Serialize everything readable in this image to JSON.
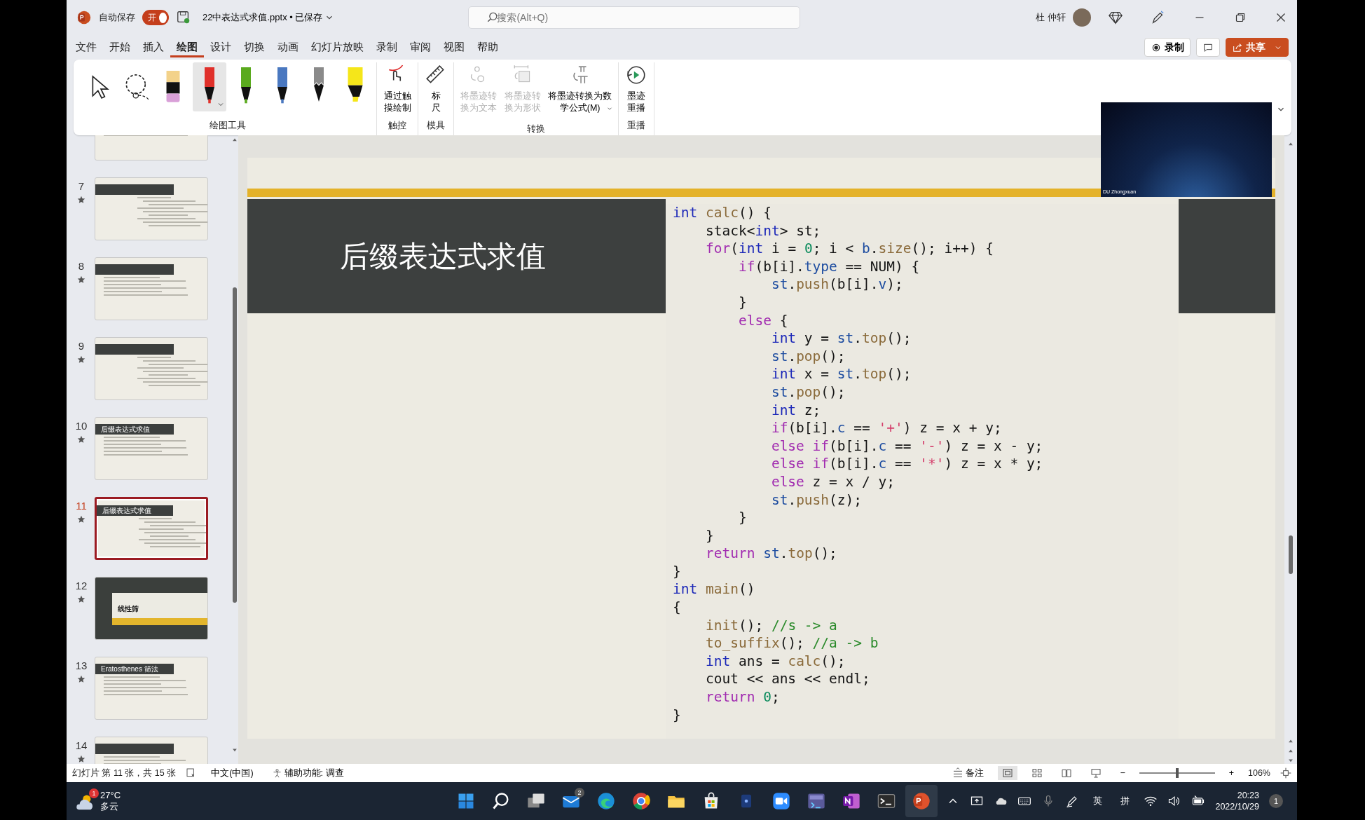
{
  "title_bar": {
    "autosave": {
      "label": "自动保存",
      "toggle_label": "开",
      "on": true
    },
    "file_name": "22中表达式求值.pptx • 已保存",
    "search": {
      "placeholder": "搜索(Alt+Q)"
    },
    "user": {
      "name": "杜 仲轩"
    }
  },
  "ribbon_tabs": [
    {
      "label": "文件",
      "selected": false
    },
    {
      "label": "开始",
      "selected": false
    },
    {
      "label": "插入",
      "selected": false
    },
    {
      "label": "绘图",
      "selected": true
    },
    {
      "label": "设计",
      "selected": false
    },
    {
      "label": "切换",
      "selected": false
    },
    {
      "label": "动画",
      "selected": false
    },
    {
      "label": "幻灯片放映",
      "selected": false
    },
    {
      "label": "录制",
      "selected": false
    },
    {
      "label": "审阅",
      "selected": false
    },
    {
      "label": "视图",
      "selected": false
    },
    {
      "label": "帮助",
      "selected": false
    }
  ],
  "actions": [
    {
      "kind": "record",
      "label": "录制"
    },
    {
      "kind": "comment"
    },
    {
      "kind": "share",
      "label": "共享"
    }
  ],
  "ribbon_groups": [
    {
      "label": "绘图工具",
      "tools": [
        {
          "kind": "select",
          "selected": false
        },
        {
          "kind": "lasso",
          "selected": false
        },
        {
          "kind": "eraser",
          "selected": false
        },
        {
          "kind": "pen",
          "color": "#e0302a",
          "selected": true,
          "dropdown": true
        },
        {
          "kind": "pen",
          "color": "#5aaa1e",
          "selected": false
        },
        {
          "kind": "pen",
          "color": "#4a78c0",
          "selected": false
        },
        {
          "kind": "pencil",
          "color": "#8a8a8a",
          "selected": false
        },
        {
          "kind": "highlighter",
          "color": "#f5e61a",
          "selected": false
        }
      ]
    },
    {
      "label": "触控",
      "tools": [
        {
          "kind": "touch",
          "label": "通过触摸绘制",
          "disabled": false
        }
      ]
    },
    {
      "label": "模具",
      "tools": [
        {
          "kind": "ruler",
          "label": "标尺",
          "disabled": false
        }
      ]
    },
    {
      "label": "转换",
      "tools": [
        {
          "kind": "ink-text",
          "label": "将墨迹转换为文本",
          "disabled": true
        },
        {
          "kind": "ink-shape",
          "label": "将墨迹转换为形状",
          "disabled": true
        },
        {
          "kind": "ink-math",
          "label": "将墨迹转换为数学公式(M)",
          "disabled": false,
          "dropdown": true
        }
      ]
    },
    {
      "label": "重播",
      "tools": [
        {
          "kind": "replay",
          "label": "墨迹重播",
          "disabled": false
        }
      ]
    }
  ],
  "slides": [
    {
      "kind": "text",
      "selected": false
    },
    {
      "kind": "code",
      "number": "7",
      "selected": false
    },
    {
      "kind": "text",
      "number": "8",
      "selected": false
    },
    {
      "kind": "code",
      "number": "9",
      "selected": false
    },
    {
      "kind": "text",
      "number": "10",
      "title": "后缀表达式求值",
      "selected": false
    },
    {
      "kind": "code",
      "number": "11",
      "title": "后缀表达式求值",
      "selected": true
    },
    {
      "kind": "section",
      "number": "12",
      "title": "线性筛",
      "selected": false
    },
    {
      "kind": "text",
      "number": "13",
      "title": "Eratosthenes 筛法",
      "selected": false
    },
    {
      "kind": "text",
      "number": "14",
      "selected": false
    }
  ],
  "slide": {
    "title": "后缀表达式求值",
    "code": [
      [
        {
          "text": "int",
          "kind": "type"
        },
        {
          "text": " calc",
          "kind": "fn"
        },
        {
          "text": "() {",
          "kind": "p"
        }
      ],
      [
        {
          "text": "    stack<",
          "kind": "p"
        },
        {
          "text": "int",
          "kind": "type"
        },
        {
          "text": "> st;",
          "kind": "p"
        }
      ],
      [
        {
          "text": "    for",
          "kind": "kw"
        },
        {
          "text": "(",
          "kind": "p"
        },
        {
          "text": "int",
          "kind": "type"
        },
        {
          "text": " i = ",
          "kind": "p"
        },
        {
          "text": "0",
          "kind": "num"
        },
        {
          "text": "; i < ",
          "kind": "p"
        },
        {
          "text": "b",
          "kind": "mem"
        },
        {
          "text": ".",
          "kind": "p"
        },
        {
          "text": "size",
          "kind": "fn"
        },
        {
          "text": "(); i++) {",
          "kind": "p"
        }
      ],
      [
        {
          "text": "        if",
          "kind": "kw"
        },
        {
          "text": "(b[i].",
          "kind": "p"
        },
        {
          "text": "type",
          "kind": "mem"
        },
        {
          "text": " == NUM) {",
          "kind": "p"
        }
      ],
      [
        {
          "text": "            st",
          "kind": "mem"
        },
        {
          "text": ".",
          "kind": "p"
        },
        {
          "text": "push",
          "kind": "fn"
        },
        {
          "text": "(b[i].",
          "kind": "p"
        },
        {
          "text": "v",
          "kind": "mem"
        },
        {
          "text": ");",
          "kind": "p"
        }
      ],
      [
        {
          "text": "        }",
          "kind": "p"
        }
      ],
      [
        {
          "text": "        else",
          "kind": "kw"
        },
        {
          "text": " {",
          "kind": "p"
        }
      ],
      [
        {
          "text": "            int",
          "kind": "type"
        },
        {
          "text": " y = ",
          "kind": "p"
        },
        {
          "text": "st",
          "kind": "mem"
        },
        {
          "text": ".",
          "kind": "p"
        },
        {
          "text": "top",
          "kind": "fn"
        },
        {
          "text": "();",
          "kind": "p"
        }
      ],
      [
        {
          "text": "            st",
          "kind": "mem"
        },
        {
          "text": ".",
          "kind": "p"
        },
        {
          "text": "pop",
          "kind": "fn"
        },
        {
          "text": "();",
          "kind": "p"
        }
      ],
      [
        {
          "text": "            int",
          "kind": "type"
        },
        {
          "text": " x = ",
          "kind": "p"
        },
        {
          "text": "st",
          "kind": "mem"
        },
        {
          "text": ".",
          "kind": "p"
        },
        {
          "text": "top",
          "kind": "fn"
        },
        {
          "text": "();",
          "kind": "p"
        }
      ],
      [
        {
          "text": "            st",
          "kind": "mem"
        },
        {
          "text": ".",
          "kind": "p"
        },
        {
          "text": "pop",
          "kind": "fn"
        },
        {
          "text": "();",
          "kind": "p"
        }
      ],
      [
        {
          "text": "            int",
          "kind": "type"
        },
        {
          "text": " z;",
          "kind": "p"
        }
      ],
      [
        {
          "text": "            if",
          "kind": "kw"
        },
        {
          "text": "(b[i].",
          "kind": "p"
        },
        {
          "text": "c",
          "kind": "mem"
        },
        {
          "text": " == ",
          "kind": "p"
        },
        {
          "text": "'+'",
          "kind": "str"
        },
        {
          "text": ") z = x + y;",
          "kind": "p"
        }
      ],
      [
        {
          "text": "            else if",
          "kind": "kw"
        },
        {
          "text": "(b[i].",
          "kind": "p"
        },
        {
          "text": "c",
          "kind": "mem"
        },
        {
          "text": " == ",
          "kind": "p"
        },
        {
          "text": "'-'",
          "kind": "str"
        },
        {
          "text": ") z = x - y;",
          "kind": "p"
        }
      ],
      [
        {
          "text": "            else if",
          "kind": "kw"
        },
        {
          "text": "(b[i].",
          "kind": "p"
        },
        {
          "text": "c",
          "kind": "mem"
        },
        {
          "text": " == ",
          "kind": "p"
        },
        {
          "text": "'*'",
          "kind": "str"
        },
        {
          "text": ") z = x * y;",
          "kind": "p"
        }
      ],
      [
        {
          "text": "            else",
          "kind": "kw"
        },
        {
          "text": " z = x / y;",
          "kind": "p"
        }
      ],
      [
        {
          "text": "            st",
          "kind": "mem"
        },
        {
          "text": ".",
          "kind": "p"
        },
        {
          "text": "push",
          "kind": "fn"
        },
        {
          "text": "(z);",
          "kind": "p"
        }
      ],
      [
        {
          "text": "        }",
          "kind": "p"
        }
      ],
      [
        {
          "text": "    }",
          "kind": "p"
        }
      ],
      [
        {
          "text": "    return",
          "kind": "kw"
        },
        {
          "text": " st",
          "kind": "mem"
        },
        {
          "text": ".",
          "kind": "p"
        },
        {
          "text": "top",
          "kind": "fn"
        },
        {
          "text": "();",
          "kind": "p"
        }
      ],
      [
        {
          "text": "}",
          "kind": "p"
        }
      ],
      [
        {
          "text": "int",
          "kind": "type"
        },
        {
          "text": " main",
          "kind": "fn"
        },
        {
          "text": "()",
          "kind": "p"
        }
      ],
      [
        {
          "text": "{",
          "kind": "p"
        }
      ],
      [
        {
          "text": "    init",
          "kind": "fn"
        },
        {
          "text": "(); ",
          "kind": "p"
        },
        {
          "text": "//s -> a",
          "kind": "cm"
        }
      ],
      [
        {
          "text": "    to_suffix",
          "kind": "fn"
        },
        {
          "text": "(); ",
          "kind": "p"
        },
        {
          "text": "//a -> b",
          "kind": "cm"
        }
      ],
      [
        {
          "text": "    int",
          "kind": "type"
        },
        {
          "text": " ans = ",
          "kind": "p"
        },
        {
          "text": "calc",
          "kind": "fn"
        },
        {
          "text": "();",
          "kind": "p"
        }
      ],
      [
        {
          "text": "    cout << ans << endl;",
          "kind": "p"
        }
      ],
      [
        {
          "text": "    return",
          "kind": "kw"
        },
        {
          "text": " 0",
          "kind": "num"
        },
        {
          "text": ";",
          "kind": "p"
        }
      ],
      [
        {
          "text": "}",
          "kind": "p"
        }
      ]
    ]
  },
  "webcam": {
    "caption": "DU Zhongxuan"
  },
  "status_bar": {
    "slide_info": "幻灯片 第 11 张，共 15 张",
    "language": "中文(中国)",
    "accessibility": "辅助功能: 调查",
    "notes": "备注",
    "views": [
      {
        "kind": "normal",
        "selected": true
      },
      {
        "kind": "sorter",
        "selected": false
      },
      {
        "kind": "reading",
        "selected": false
      },
      {
        "kind": "show",
        "selected": false
      }
    ],
    "zoom_out": "−",
    "zoom_in": "+",
    "zoom": {
      "level": 0.5,
      "reading": "106%"
    }
  },
  "taskbar": {
    "weather": {
      "temperature": "27°C",
      "condition": "多云",
      "badge": "1"
    },
    "apps": [
      {
        "kind": "start",
        "selected": false
      },
      {
        "kind": "search",
        "selected": false
      },
      {
        "kind": "taskview",
        "selected": false
      },
      {
        "kind": "mail",
        "badge": "2",
        "selected": false
      },
      {
        "kind": "edge",
        "selected": false
      },
      {
        "kind": "chrome",
        "selected": false
      },
      {
        "kind": "folder",
        "selected": false
      },
      {
        "kind": "store",
        "selected": false
      },
      {
        "kind": "app",
        "selected": false
      },
      {
        "kind": "video",
        "selected": false
      },
      {
        "kind": "ide",
        "selected": false
      },
      {
        "kind": "notebook",
        "selected": false
      },
      {
        "kind": "terminal",
        "selected": false
      },
      {
        "kind": "presentation",
        "selected": true
      }
    ],
    "tray": {
      "ime": [
        "英",
        "拼"
      ],
      "time": "20:23",
      "date": "2022/10/29",
      "notifications": "1"
    }
  }
}
